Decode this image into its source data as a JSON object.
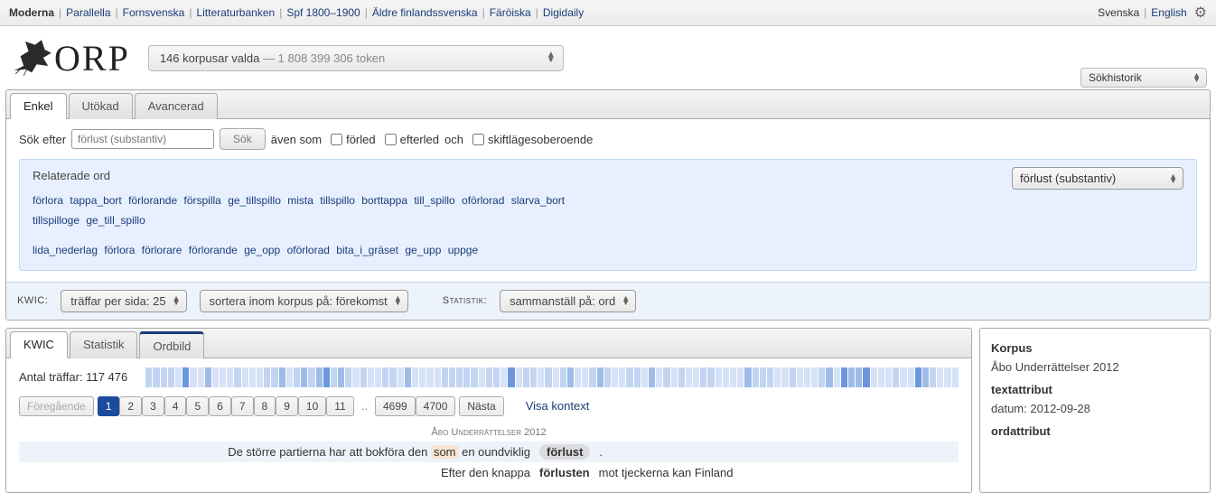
{
  "topnav": {
    "items": [
      "Moderna",
      "Parallella",
      "Fornsvenska",
      "Litteraturbanken",
      "Spf 1800–1900",
      "Äldre finlandssvenska",
      "Färöiska",
      "Digidaily"
    ],
    "langs": [
      "Svenska",
      "English"
    ]
  },
  "logo_text": "ORP",
  "corpus_selector": {
    "count": "146 korpusar valda",
    "tokens": "1 808 399 306 token"
  },
  "search_history": {
    "label": "Sökhistorik"
  },
  "mode_tabs": [
    "Enkel",
    "Utökad",
    "Avancerad"
  ],
  "search": {
    "label": "Sök efter",
    "placeholder": "förlust (substantiv)",
    "button": "Sök",
    "also_as": "även som",
    "prefix": "förled",
    "suffix": "efterled",
    "and": "och",
    "case_insensitive": "skiftlägesoberoende"
  },
  "related": {
    "title": "Relaterade ord",
    "dropdown": "förlust (substantiv)",
    "row1": [
      "förlora",
      "tappa_bort",
      "förlorande",
      "förspilla",
      "ge_tillspillo",
      "mista",
      "tillspillo",
      "borttappa",
      "till_spillo",
      "oförlorad",
      "slarva_bort",
      "tillspilloge",
      "ge_till_spillo"
    ],
    "row2": [
      "lida_nederlag",
      "förlora",
      "förlorare",
      "förlorande",
      "ge_opp",
      "oförlorad",
      "bita_i_gräset",
      "ge_upp",
      "uppge"
    ]
  },
  "controls": {
    "kwic_label": "KWIC:",
    "hits_per_page": "träffar per sida: 25",
    "sort": "sortera inom korpus på: förekomst",
    "stats_label": "Statistik:",
    "compile": "sammanställ på: ord"
  },
  "result_tabs": [
    "KWIC",
    "Statistik",
    "Ordbild"
  ],
  "hits": {
    "label": "Antal träffar:",
    "count": "117 476"
  },
  "pager": {
    "prev": "Föregående",
    "pages": [
      "1",
      "2",
      "3",
      "4",
      "5",
      "6",
      "7",
      "8",
      "9",
      "10",
      "11"
    ],
    "dots": "..",
    "last_pages": [
      "4699",
      "4700"
    ],
    "next": "Nästa",
    "view_context": "Visa kontext"
  },
  "kwic": {
    "corpus_heading": "Åbo Underrättelser 2012",
    "lines": [
      {
        "left_pre": "De större partierna har att bokföra den ",
        "left_hl": "som",
        "left_post": " en oundviklig",
        "mid": "förlust",
        "right": ".",
        "alt": true,
        "pill": true
      },
      {
        "left_pre": "Efter den knappa ",
        "left_hl": "",
        "left_post": "",
        "mid": "förlusten",
        "right": "mot tjeckerna kan Finland",
        "alt": false,
        "pill": false
      }
    ]
  },
  "sidebar": {
    "korpus_h": "Korpus",
    "korpus_v": "Åbo Underrättelser 2012",
    "textattr_h": "textattribut",
    "date_label": "datum:",
    "date_value": "2012-09-28",
    "ordattr_h": "ordattribut"
  }
}
